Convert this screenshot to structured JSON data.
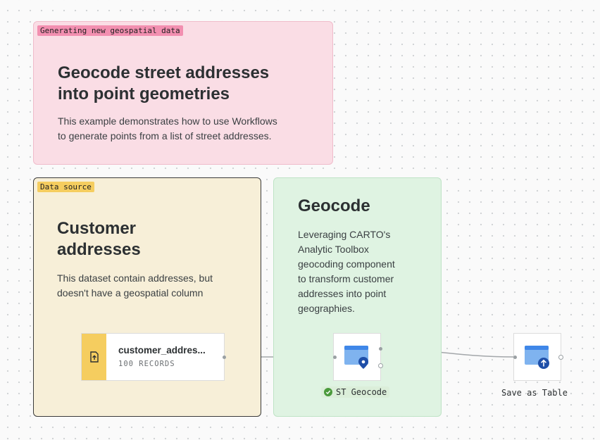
{
  "groups": {
    "intro": {
      "tag": "Generating new geospatial data",
      "title_line1": "Geocode street addresses",
      "title_line2": "into point geometries",
      "body_line1": "This example demonstrates how to use Workflows",
      "body_line2": "to generate points from a list of street addresses.",
      "color": "#fadde5"
    },
    "source": {
      "tag": "Data source",
      "title_line1": "Customer",
      "title_line2": "addresses",
      "body_line1": "This dataset contain addresses, but",
      "body_line2": "doesn't have a geospatial column",
      "color": "#f7efd8"
    },
    "geocode": {
      "title": "Geocode",
      "body_lines": [
        "Leveraging CARTO's",
        "Analytic Toolbox",
        "geocoding component",
        "to transform customer",
        "addresses into point",
        "geographies."
      ],
      "color": "#dff3e2"
    }
  },
  "nodes": {
    "source_table": {
      "name": "customer_addres...",
      "records": "100 RECORDS",
      "icon": "upload-table-icon"
    },
    "st_geocode": {
      "label": "ST Geocode",
      "status": "success",
      "icon": "geocode-pin-icon"
    },
    "save_table": {
      "label": "Save as Table",
      "icon": "save-table-icon"
    }
  }
}
